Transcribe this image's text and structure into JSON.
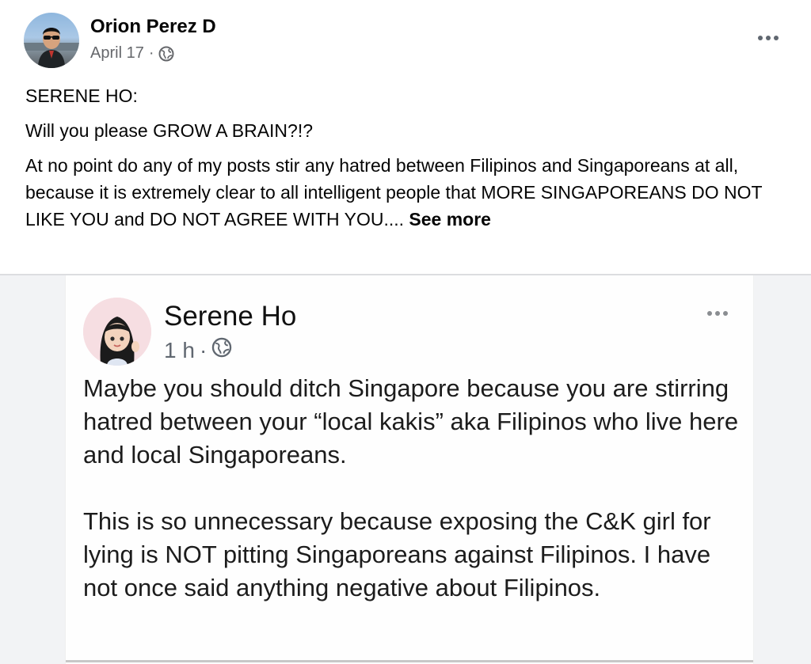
{
  "post": {
    "author_name": "Orion Perez D",
    "date": "April 17",
    "separator": "·",
    "privacy_icon": "globe-icon",
    "more_icon": "more-options-icon",
    "paragraphs": [
      "SERENE HO:",
      "Will you please GROW A BRAIN?!?"
    ],
    "body_truncated": "At no point do any of my posts stir any hatred between Filipinos and Singaporeans at all, because it is extremely clear to all intelligent people that MORE SINGAPOREANS DO NOT LIKE YOU and DO NOT AGREE WITH YOU....",
    "see_more_label": "See more"
  },
  "embedded_post": {
    "author_name": "Serene Ho",
    "time": "1 h",
    "separator": "·",
    "privacy_icon": "globe-icon",
    "paragraphs": [
      "Maybe you should ditch Singapore because you are stirring hatred between your “local kakis” aka Filipinos who live here and local Singaporeans.",
      "This is so unnecessary because exposing the C&K girl for lying is NOT pitting Singaporeans against Filipinos. I have not once said anything negative about Filipinos."
    ]
  },
  "colors": {
    "text_primary": "#050505",
    "text_secondary": "#65676b",
    "divider": "#dcdde0"
  }
}
